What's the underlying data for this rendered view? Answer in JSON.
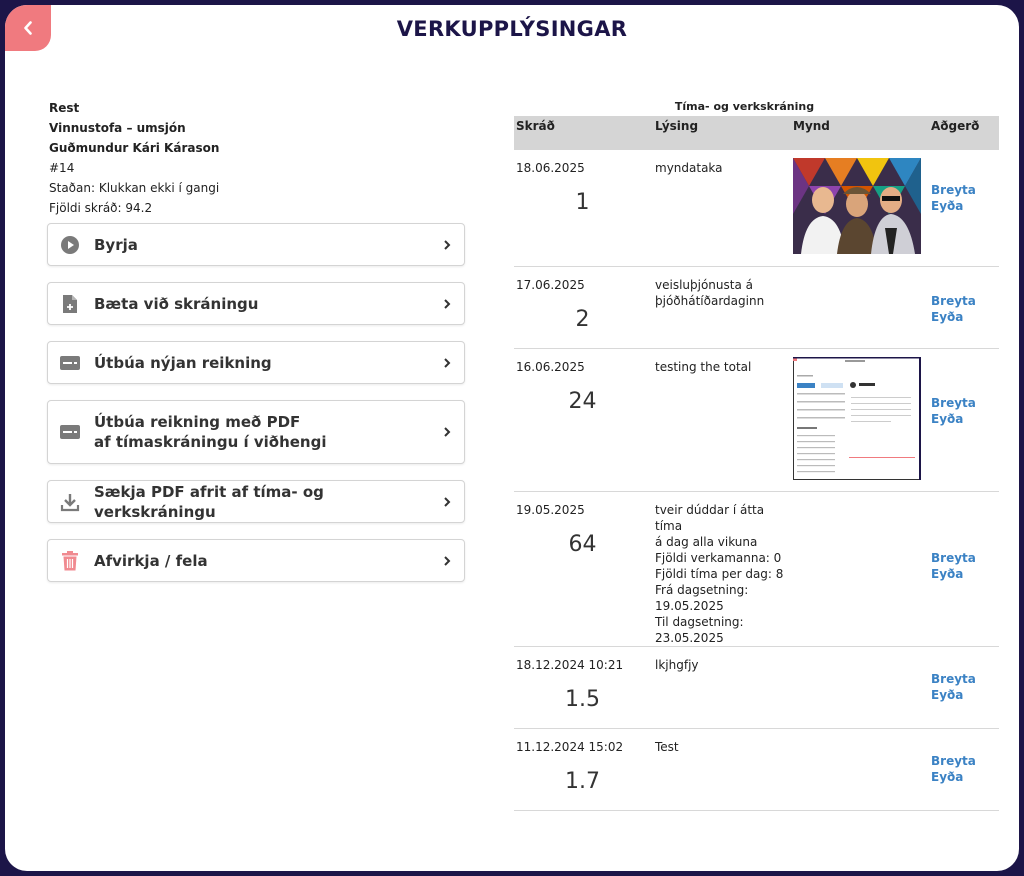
{
  "header": {
    "title": "VERKUPPLÝSINGAR"
  },
  "project": {
    "name": "Rest",
    "category": "Vinnustofa – umsjón",
    "person": "Guðmundur Kári Kárason",
    "number": "#14",
    "status": "Staðan: Klukkan ekki í gangi",
    "logged": "Fjöldi skráð: 94.2"
  },
  "actions": {
    "start": "Byrja",
    "add_entry": "Bæta við skráningu",
    "new_invoice": "Útbúa nýjan reikning",
    "invoice_pdf": "Útbúa reikning með PDF\naf tímaskráningu í viðhengi",
    "download_pdf": "Sækja PDF afrit af tíma- og verkskráningu",
    "deactivate": "Afvirkja / fela"
  },
  "table": {
    "caption": "Tíma- og verkskráning",
    "headers": [
      "Skráð",
      "Lýsing",
      "Mynd",
      "Aðgerð"
    ],
    "edit_label": "Breyta",
    "delete_label": "Eyða",
    "rows": [
      {
        "date": "18.06.2025",
        "hours": "1",
        "desc": "myndataka",
        "image": "photo"
      },
      {
        "date": "17.06.2025",
        "hours": "2",
        "desc": "veisluþjónusta á\nþjóðhátíðardaginn",
        "image": ""
      },
      {
        "date": "16.06.2025",
        "hours": "24",
        "desc": "testing the total",
        "image": "screenshot"
      },
      {
        "date": "19.05.2025",
        "hours": "64",
        "desc": "tveir dúddar í átta tíma\ná dag alla vikuna\nFjöldi verkamanna: 0\nFjöldi tíma per dag: 8\nFrá dagsetning:\n19.05.2025\nTil dagsetning:\n23.05.2025",
        "image": ""
      },
      {
        "date": "18.12.2024 10:21",
        "hours": "1.5",
        "desc": "lkjhgfjy",
        "image": ""
      },
      {
        "date": "11.12.2024 15:02",
        "hours": "1.7",
        "desc": "Test",
        "image": ""
      }
    ]
  },
  "colors": {
    "background": "#1c1548",
    "title": "#1c1548",
    "back_button": "#f07a7f",
    "link": "#3b82c4",
    "header_row": "#d5d5d5",
    "trash_icon": "#f08a90"
  },
  "icons": {
    "back": "chevron-left-icon",
    "start": "play-circle-icon",
    "add_entry": "file-plus-icon",
    "invoice": "card-icon",
    "download": "download-icon",
    "deactivate": "trash-icon",
    "row_arrow": "chevron-right-icon"
  }
}
